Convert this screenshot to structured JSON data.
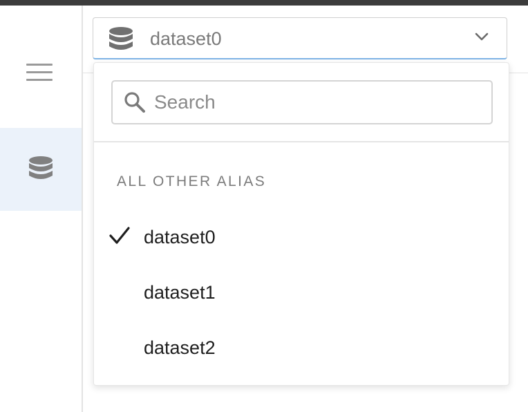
{
  "selector": {
    "selected_value": "dataset0",
    "icon": "database-icon",
    "chevron_icon": "chevron-down-icon"
  },
  "sidebar": {
    "menu_icon": "hamburger-menu-icon",
    "active_item_icon": "database-icon"
  },
  "dropdown": {
    "search": {
      "placeholder": "Search",
      "value": ""
    },
    "section_heading": "ALL OTHER ALIAS",
    "options": [
      {
        "label": "dataset0",
        "selected": true
      },
      {
        "label": "dataset1",
        "selected": false
      },
      {
        "label": "dataset2",
        "selected": false
      }
    ]
  },
  "colors": {
    "topbar": "#3c3c3c",
    "active_sidebar_bg": "#ebf2fa",
    "focus_underline": "#7fb4e6",
    "icon_gray": "#707070"
  }
}
